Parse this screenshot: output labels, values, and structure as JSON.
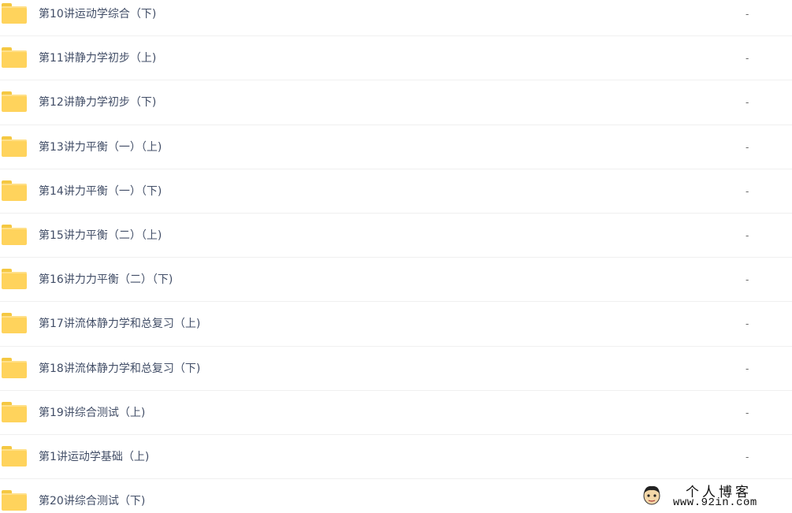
{
  "files": [
    {
      "name": "第10讲运动学综合（下)",
      "size": "-"
    },
    {
      "name": "第11讲静力学初步（上)",
      "size": "-"
    },
    {
      "name": "第12讲静力学初步（下)",
      "size": "-"
    },
    {
      "name": "第13讲力平衡（一）（上)",
      "size": "-"
    },
    {
      "name": "第14讲力平衡（一）（下)",
      "size": "-"
    },
    {
      "name": "第15讲力平衡（二）（上)",
      "size": "-"
    },
    {
      "name": "第16讲力力平衡（二）（下)",
      "size": "-"
    },
    {
      "name": "第17讲流体静力学和总复习（上)",
      "size": "-"
    },
    {
      "name": "第18讲流体静力学和总复习（下)",
      "size": "-"
    },
    {
      "name": "第19讲综合测试（上)",
      "size": "-"
    },
    {
      "name": "第1讲运动学基础（上)",
      "size": "-"
    },
    {
      "name": "第20讲综合测试（下)",
      "size": "-"
    }
  ],
  "icons": {
    "folder": "folder-icon"
  },
  "colors": {
    "folder": "#ffd35c",
    "text": "#424e67",
    "divider": "#f0f0f0"
  },
  "watermark": {
    "title": "个人博客",
    "url": "www.92in.com"
  }
}
